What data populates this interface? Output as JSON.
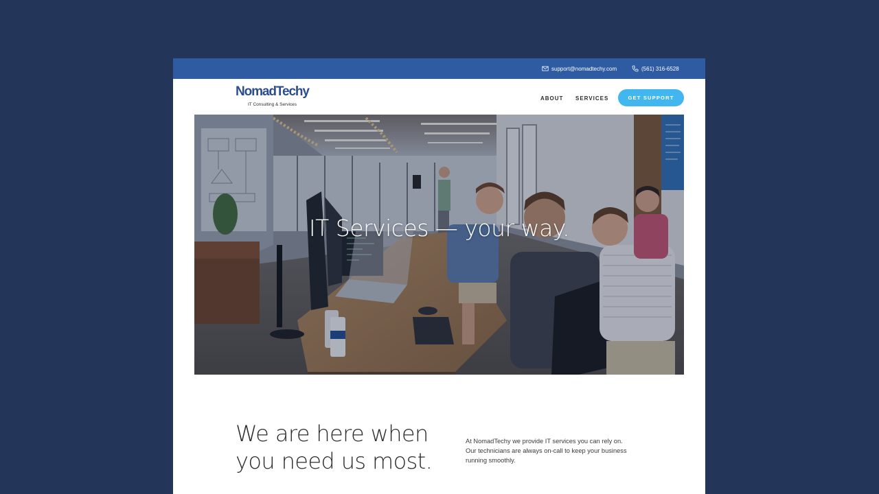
{
  "colors": {
    "background": "#233659",
    "topbar": "#2f5ba3",
    "brand": "#2a4d8f",
    "cta": "#41b6ef"
  },
  "topbar": {
    "email": "support@nomadtechy.com",
    "email_icon": "envelope-icon",
    "phone": "(561) 316-6528",
    "phone_icon": "phone-icon"
  },
  "header": {
    "logo": {
      "name": "NomadTechy",
      "tagline": "IT Consulting & Services"
    },
    "nav": {
      "about": "ABOUT",
      "services": "SERVICES"
    },
    "cta_label": "GET SUPPORT"
  },
  "hero": {
    "title": "IT Services  —  your way."
  },
  "intro": {
    "heading_line1": "We are here when",
    "heading_line2": "you need us most.",
    "body_line1": "At NomadTechy we provide IT services you can rely on.",
    "body_line2": "Our technicians are always on-call to keep your business",
    "body_line3": "running smoothly."
  }
}
